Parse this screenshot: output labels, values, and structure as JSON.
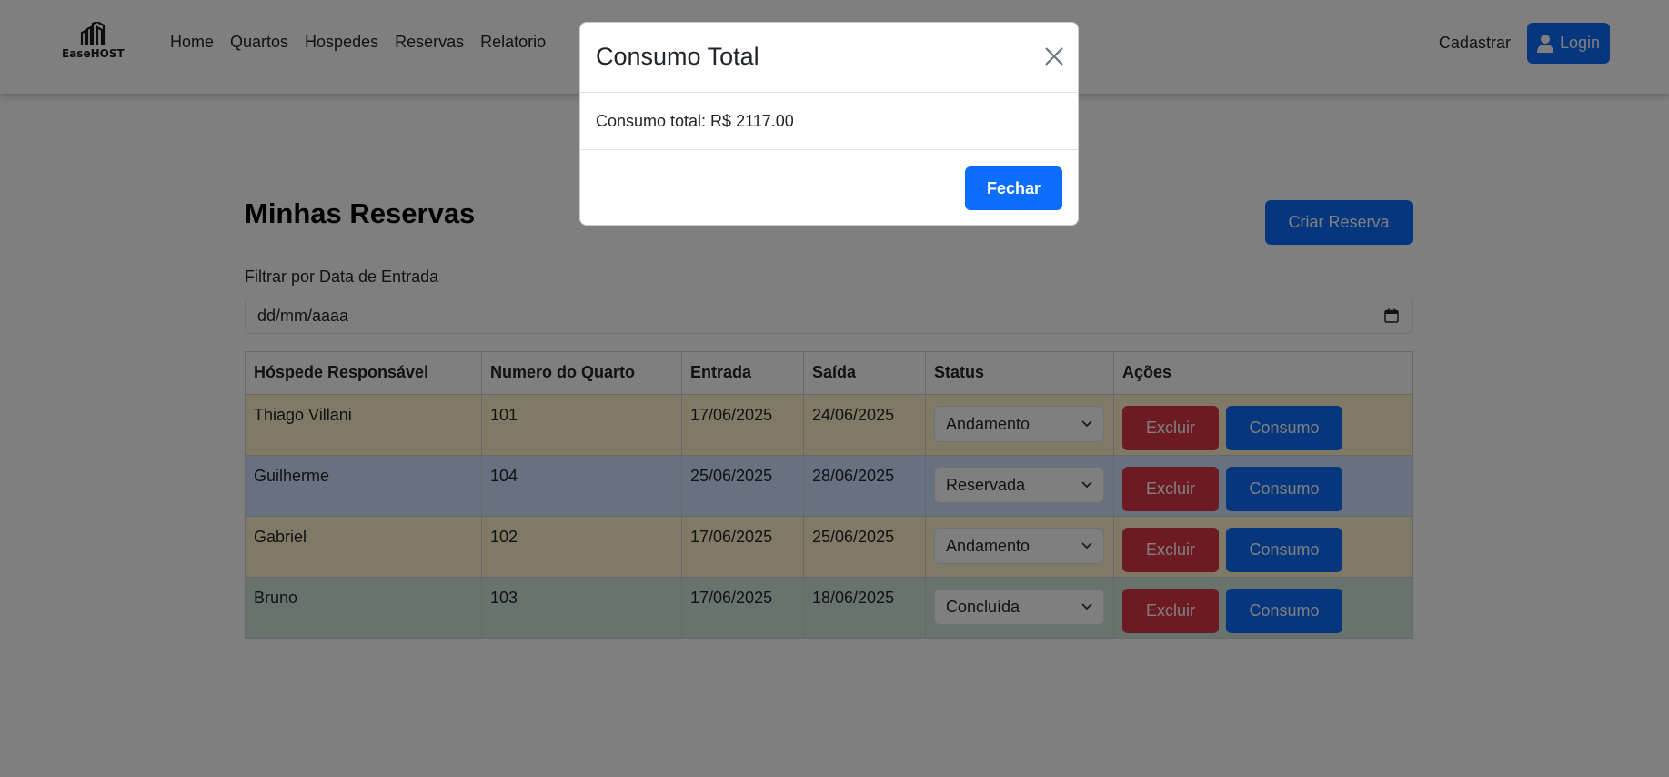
{
  "brand": {
    "name": "EaseHOST"
  },
  "nav": {
    "links": [
      "Home",
      "Quartos",
      "Hospedes",
      "Reservas",
      "Relatorio"
    ],
    "register_label": "Cadastrar",
    "login_label": "Login"
  },
  "page": {
    "title": "Minhas Reservas",
    "create_button": "Criar Reserva",
    "filter_label": "Filtrar por Data de Entrada",
    "filter_placeholder": "dd/mm/aaaa"
  },
  "table": {
    "headers": [
      "Hóspede Responsável",
      "Numero do Quarto",
      "Entrada",
      "Saída",
      "Status",
      "Ações"
    ],
    "rows": [
      {
        "guest": "Thiago Villani",
        "room": "101",
        "checkin": "17/06/2025",
        "checkout": "24/06/2025",
        "status": "Andamento"
      },
      {
        "guest": "Guilherme",
        "room": "104",
        "checkin": "25/06/2025",
        "checkout": "28/06/2025",
        "status": "Reservada"
      },
      {
        "guest": "Gabriel",
        "room": "102",
        "checkin": "17/06/2025",
        "checkout": "25/06/2025",
        "status": "Andamento"
      },
      {
        "guest": "Bruno",
        "room": "103",
        "checkin": "17/06/2025",
        "checkout": "18/06/2025",
        "status": "Concluída"
      }
    ],
    "delete_label": "Excluir",
    "consumption_label": "Consumo"
  },
  "modal": {
    "title": "Consumo Total",
    "body": "Consumo total: R$ 2117.00",
    "close_label": "Fechar"
  },
  "colors": {
    "primary": "#0d6efd",
    "danger": "#dc3545",
    "row_andamento": "#fff3cd",
    "row_reservada": "#cfe2ff",
    "row_concluida": "#d1e7dd"
  }
}
